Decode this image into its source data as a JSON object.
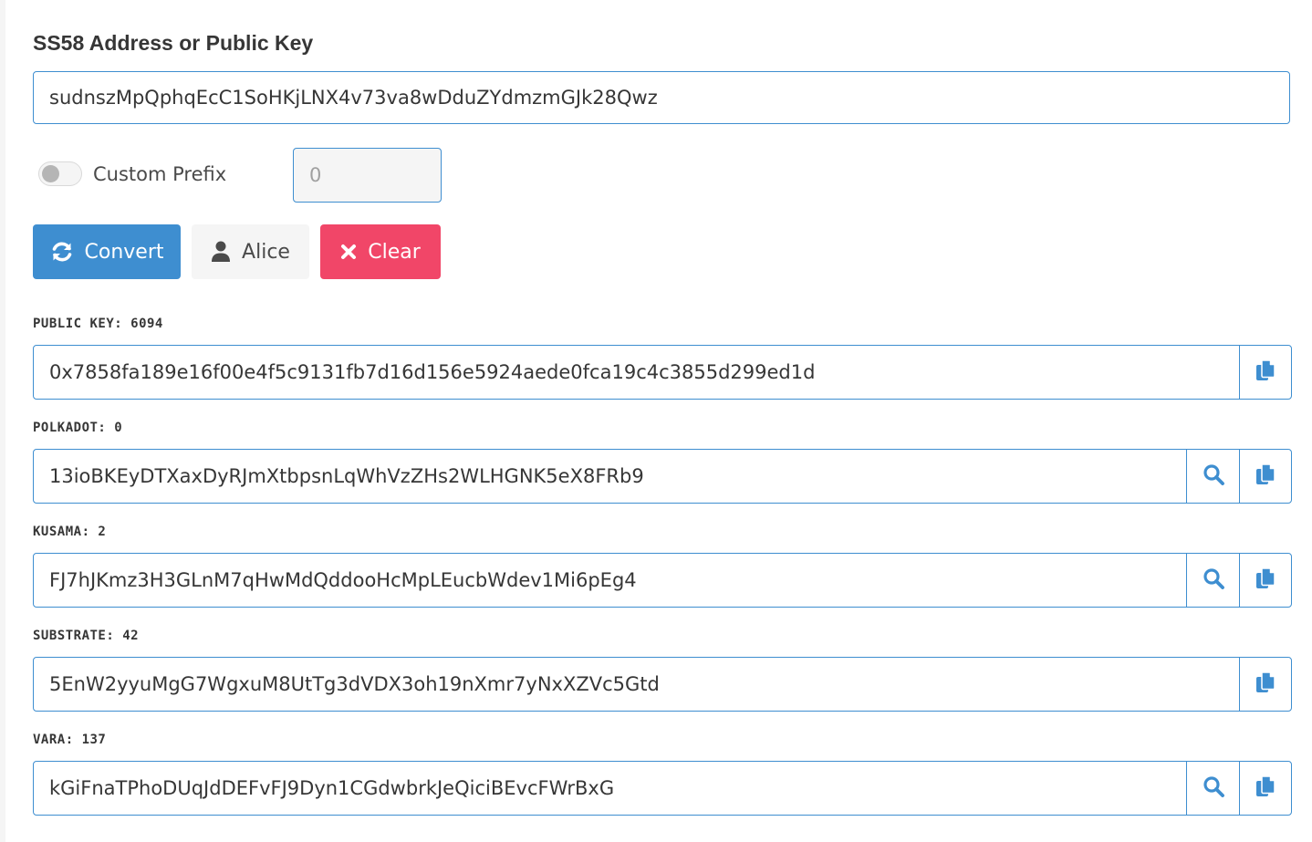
{
  "header": {
    "title": "SS58 Address or Public Key"
  },
  "address_input": {
    "value": "sudnszMpQphqEcC1SoHKjLNX4v73va8wDduZYdmzmGJk28Qwz"
  },
  "prefix": {
    "toggle_label": "Custom Prefix",
    "toggle_on": false,
    "value": "0"
  },
  "buttons": {
    "convert": "Convert",
    "alice": "Alice",
    "clear": "Clear"
  },
  "colors": {
    "primary": "#3e8ed0",
    "danger": "#f14668",
    "light": "#f5f5f5"
  },
  "results": [
    {
      "label": "PUBLIC KEY: 6094",
      "value": "0x7858fa189e16f00e4f5c9131fb7d16d156e5924aede0fca19c4c3855d299ed1d",
      "has_search": false
    },
    {
      "label": "POLKADOT: 0",
      "value": "13ioBKEyDTXaxDyRJmXtbpsnLqWhVzZHs2WLHGNK5eX8FRb9",
      "has_search": true
    },
    {
      "label": "KUSAMA: 2",
      "value": "FJ7hJKmz3H3GLnM7qHwMdQddooHcMpLEucbWdev1Mi6pEg4",
      "has_search": true
    },
    {
      "label": "SUBSTRATE: 42",
      "value": "5EnW2yyuMgG7WgxuM8UtTg3dVDX3oh19nXmr7yNxXZVc5Gtd",
      "has_search": false
    },
    {
      "label": "VARA: 137",
      "value": "kGiFnaTPhoDUqJdDEFvFJ9Dyn1CGdwbrkJeQiciBEvcFWrBxG",
      "has_search": true
    }
  ],
  "icons": {
    "convert": "sync-icon",
    "alice": "user-icon",
    "clear": "close-icon",
    "search": "search-icon",
    "copy": "copy-icon"
  }
}
